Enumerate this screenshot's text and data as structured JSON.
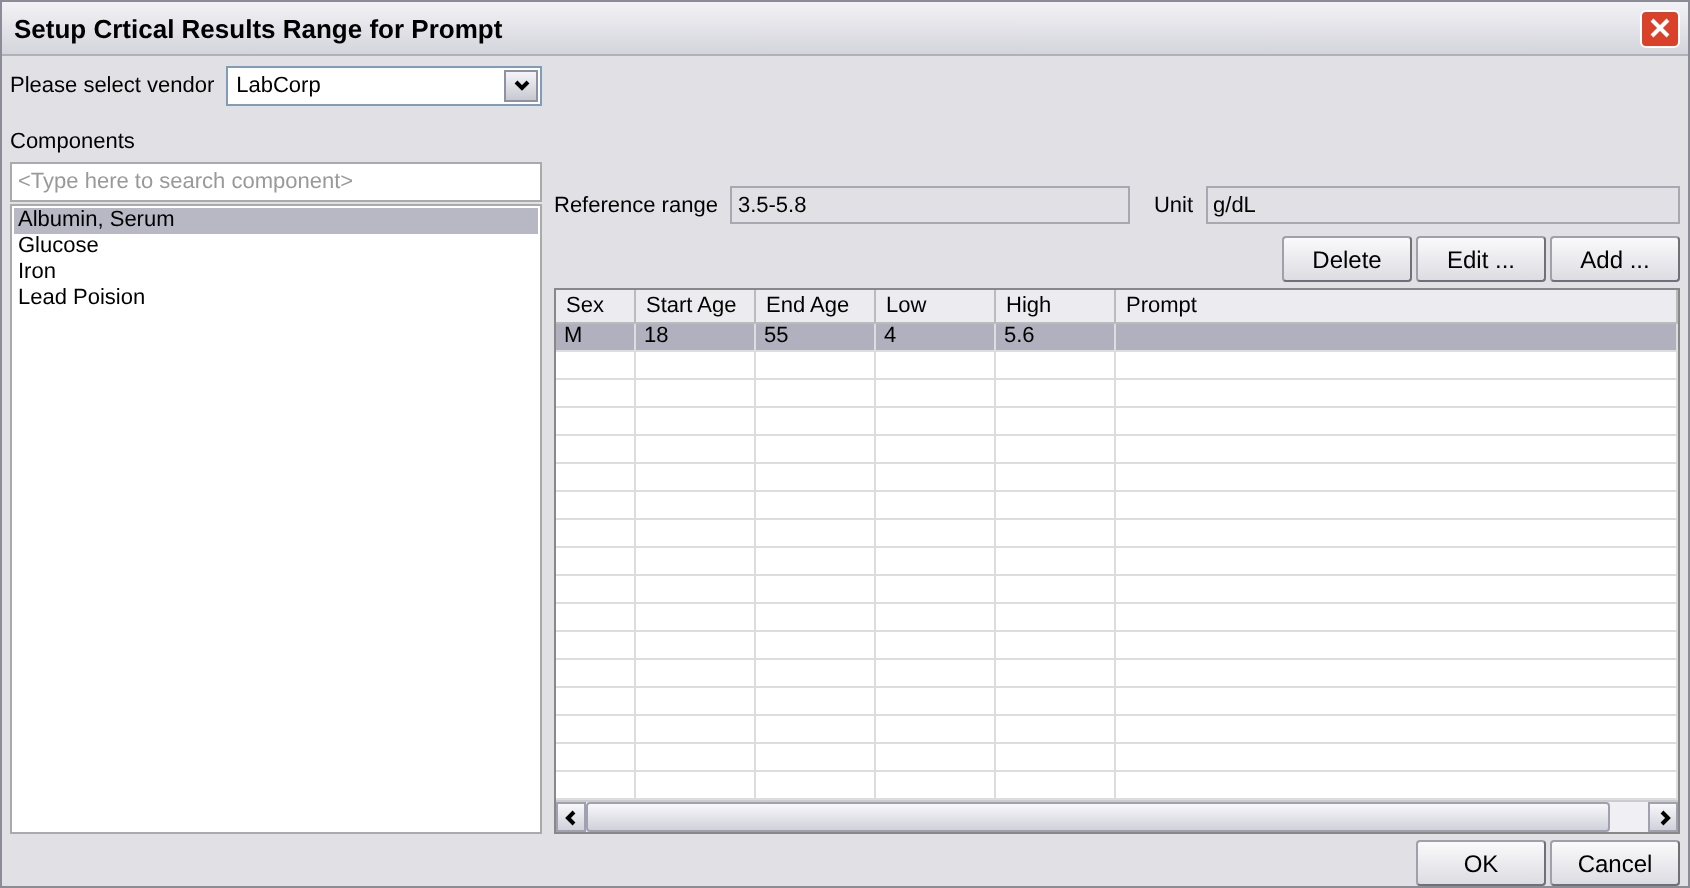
{
  "window": {
    "title": "Setup Crtical Results Range for Prompt"
  },
  "vendor": {
    "label": "Please select vendor",
    "value": "LabCorp"
  },
  "components": {
    "label": "Components",
    "search": {
      "placeholder": "<Type here to search component>"
    },
    "items": [
      {
        "label": "Albumin, Serum",
        "selected": true
      },
      {
        "label": "Glucose",
        "selected": false
      },
      {
        "label": "Iron",
        "selected": false
      },
      {
        "label": "Lead Poision",
        "selected": false
      }
    ]
  },
  "reference_range": {
    "label": "Reference range",
    "value": "3.5-5.8"
  },
  "unit": {
    "label": "Unit",
    "value": "g/dL"
  },
  "actions": [
    "Delete",
    "Edit ...",
    "Add ..."
  ],
  "table": {
    "columns": [
      "Sex",
      "Start Age",
      "End Age",
      "Low",
      "High",
      "Prompt"
    ],
    "rows": [
      {
        "cells": [
          "M",
          "18",
          "55",
          "4",
          "5.6",
          ""
        ],
        "selected": true
      }
    ]
  },
  "buttons": [
    "OK",
    "Cancel"
  ]
}
